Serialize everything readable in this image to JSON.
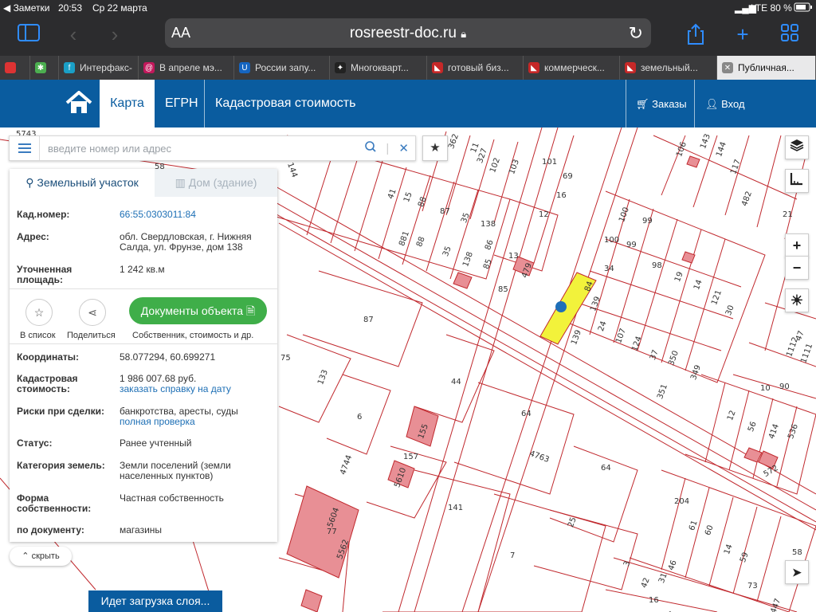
{
  "status": {
    "back_app": "◀ Заметки",
    "time": "20:53",
    "date": "Ср 22 марта",
    "network": "LTE 80 %"
  },
  "browser": {
    "aa": "AA",
    "url": "rosreestr-doc.ru",
    "tabs": [
      {
        "label": "",
        "fav": "#d33"
      },
      {
        "label": "",
        "fav": "#4caf50"
      },
      {
        "label": "Интерфакс-",
        "fav": "#1a9fc6"
      },
      {
        "label": "В апреле мэ...",
        "fav": "#c2185b"
      },
      {
        "label": "России запу...",
        "fav": "#1565c0"
      },
      {
        "label": "Многокварт...",
        "fav": "#222"
      },
      {
        "label": "готовый биз...",
        "fav": "#c62828"
      },
      {
        "label": "коммерческ...",
        "fav": "#c62828"
      },
      {
        "label": "земельный...",
        "fav": "#c62828"
      },
      {
        "label": "Публичная...",
        "fav": "#888"
      }
    ]
  },
  "nav": {
    "map": "Карта",
    "egrn": "ЕГРН",
    "cadastral": "Кадастровая стоимость",
    "orders": "Заказы",
    "login": "Вход"
  },
  "search": {
    "placeholder": "введите номер или адрес"
  },
  "panel": {
    "tab_land": "Земельный участок",
    "tab_house": "Дом (здание)",
    "cad_label": "Кад.номер:",
    "cad_value": "66:55:0303011:84",
    "addr_label": "Адрес:",
    "addr_value": "обл. Свердловская, г. Нижняя Салда, ул. Фрунзе, дом 138",
    "area_label": "Уточненная площадь:",
    "area_value": "1 242 кв.м",
    "list_label": "В список",
    "share_label": "Поделиться",
    "docs_button": "Документы объекта",
    "docs_sub": "Собственник, стоимость и др.",
    "coords_label": "Координаты:",
    "coords_value": "58.077294, 60.699271",
    "cost_label": "Кадастровая стоимость:",
    "cost_value": "1 986 007.68 руб.",
    "cost_link": "заказать справку на дату",
    "risk_label": "Риски при сделки:",
    "risk_value": "банкротства, аресты, суды",
    "risk_link": "полная проверка",
    "state_label": "Статус:",
    "state_value": "Ранее учтенный",
    "category_label": "Категория земель:",
    "category_value": "Земли поселений (земли населенных пунктов)",
    "ownership_label": "Форма собственности:",
    "ownership_value": "Частная собственность",
    "doc_label": "по документу:",
    "doc_value": "магазины",
    "hide": "скрыть"
  },
  "map_labels": [
    "5743",
    "58",
    "144",
    "362",
    "11",
    "327",
    "102",
    "103",
    "101",
    "69",
    "16",
    "12",
    "41",
    "15",
    "88",
    "87",
    "35",
    "138",
    "138",
    "85",
    "13",
    "479",
    "85",
    "86",
    "35",
    "88",
    "881",
    "87",
    "75",
    "133",
    "6",
    "44",
    "155",
    "157",
    "5610",
    "141",
    "64",
    "4763",
    "64",
    "25",
    "7",
    "5604",
    "77",
    "5562",
    "4744",
    "100",
    "99",
    "100",
    "99",
    "98",
    "34",
    "84",
    "139",
    "139",
    "24",
    "107",
    "124",
    "37",
    "350",
    "349",
    "351",
    "19",
    "14",
    "121",
    "30",
    "106",
    "143",
    "144",
    "117",
    "482",
    "21",
    "47",
    "1112",
    "1111",
    "10",
    "12",
    "56",
    "414",
    "536",
    "90",
    "572",
    "204",
    "61",
    "60",
    "14",
    "59",
    "58",
    "46",
    "73",
    "16",
    "31",
    "42",
    "43",
    "3",
    "5447"
  ],
  "loading": "Идет загрузка слоя...",
  "colors": {
    "brand_blue": "#0a5c9f",
    "parcel_line": "#c0282d",
    "building_fill": "#e88f95",
    "selected_parcel": "#f2f23b",
    "green_button": "#3fae49"
  }
}
